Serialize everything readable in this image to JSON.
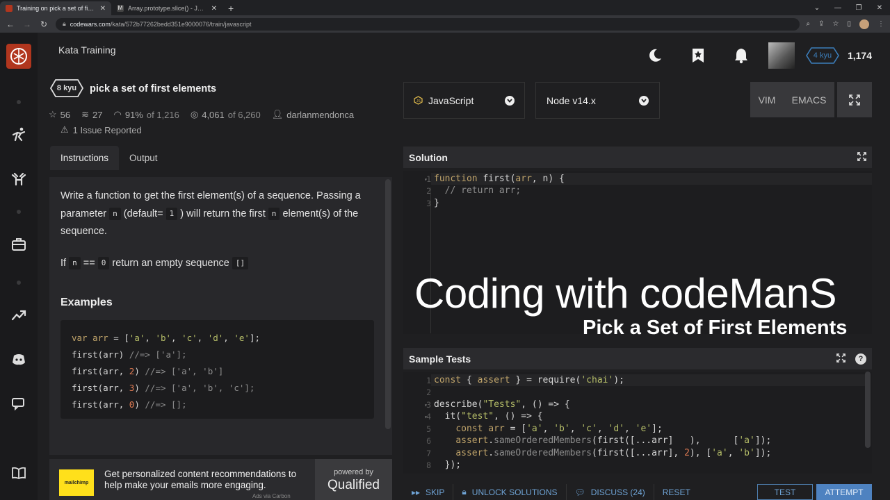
{
  "browser": {
    "tabs": [
      {
        "title": "Training on pick a set of first elem",
        "favicon_color": "#b1361e"
      },
      {
        "title": "Array.prototype.slice() - JavaScrip",
        "favicon_color": "#444444"
      }
    ],
    "url_domain": "codewars.com",
    "url_path": "/kata/572b77262bedd351e9000076/train/javascript"
  },
  "header": {
    "section_title": "Kata Training",
    "rank": "4 kyu",
    "honor": "1,174"
  },
  "kata": {
    "kyu": "8 kyu",
    "title": "pick a set of first elements",
    "stars": "56",
    "collections": "27",
    "satisfaction": "91%",
    "satisfaction_of": "of 1,216",
    "completed": "4,061",
    "completed_of": "of 6,260",
    "author": "darlanmendonca",
    "issues": "1 Issue Reported"
  },
  "tabs": {
    "instructions": "Instructions",
    "output": "Output"
  },
  "instructions": {
    "p1_a": "Write a function to get the first element(s) of a sequence. Passing a parameter ",
    "p1_code1": "n",
    "p1_b": " (default= ",
    "p1_code2": "1",
    "p1_c": " ) will return the first ",
    "p1_code3": "n",
    "p1_d": " element(s) of the sequence.",
    "p2_a": "If ",
    "p2_code1": "n",
    "p2_b": " == ",
    "p2_code2": "0",
    "p2_c": " return an empty sequence ",
    "p2_code3": "[]",
    "examples_heading": "Examples"
  },
  "ad": {
    "logo_text": "mailchimp",
    "text": "Get personalized content recommendations to help make your emails more engaging.",
    "powered_by": "powered by",
    "brand": "Qualified",
    "ads_via": "Ads via Carbon"
  },
  "editor_controls": {
    "language": "JavaScript",
    "version": "Node v14.x",
    "vim": "VIM",
    "emacs": "EMACS"
  },
  "solution": {
    "title": "Solution",
    "line_numbers": [
      "1",
      "2",
      "3"
    ]
  },
  "overlay": {
    "title": "Coding with codeManS",
    "subtitle": "Pick a Set of First Elements"
  },
  "sample_tests": {
    "title": "Sample Tests",
    "line_numbers": [
      "1",
      "2",
      "3",
      "4",
      "5",
      "6",
      "7",
      "8"
    ]
  },
  "actions": {
    "skip": "SKIP",
    "unlock": "UNLOCK SOLUTIONS",
    "discuss": "DISCUSS (24)",
    "reset": "RESET",
    "test": "TEST",
    "attempt": "ATTEMPT"
  },
  "colors": {
    "brand_red": "#b1361e",
    "link_blue": "#6fa4d6",
    "attempt_blue": "#4e82c0"
  }
}
